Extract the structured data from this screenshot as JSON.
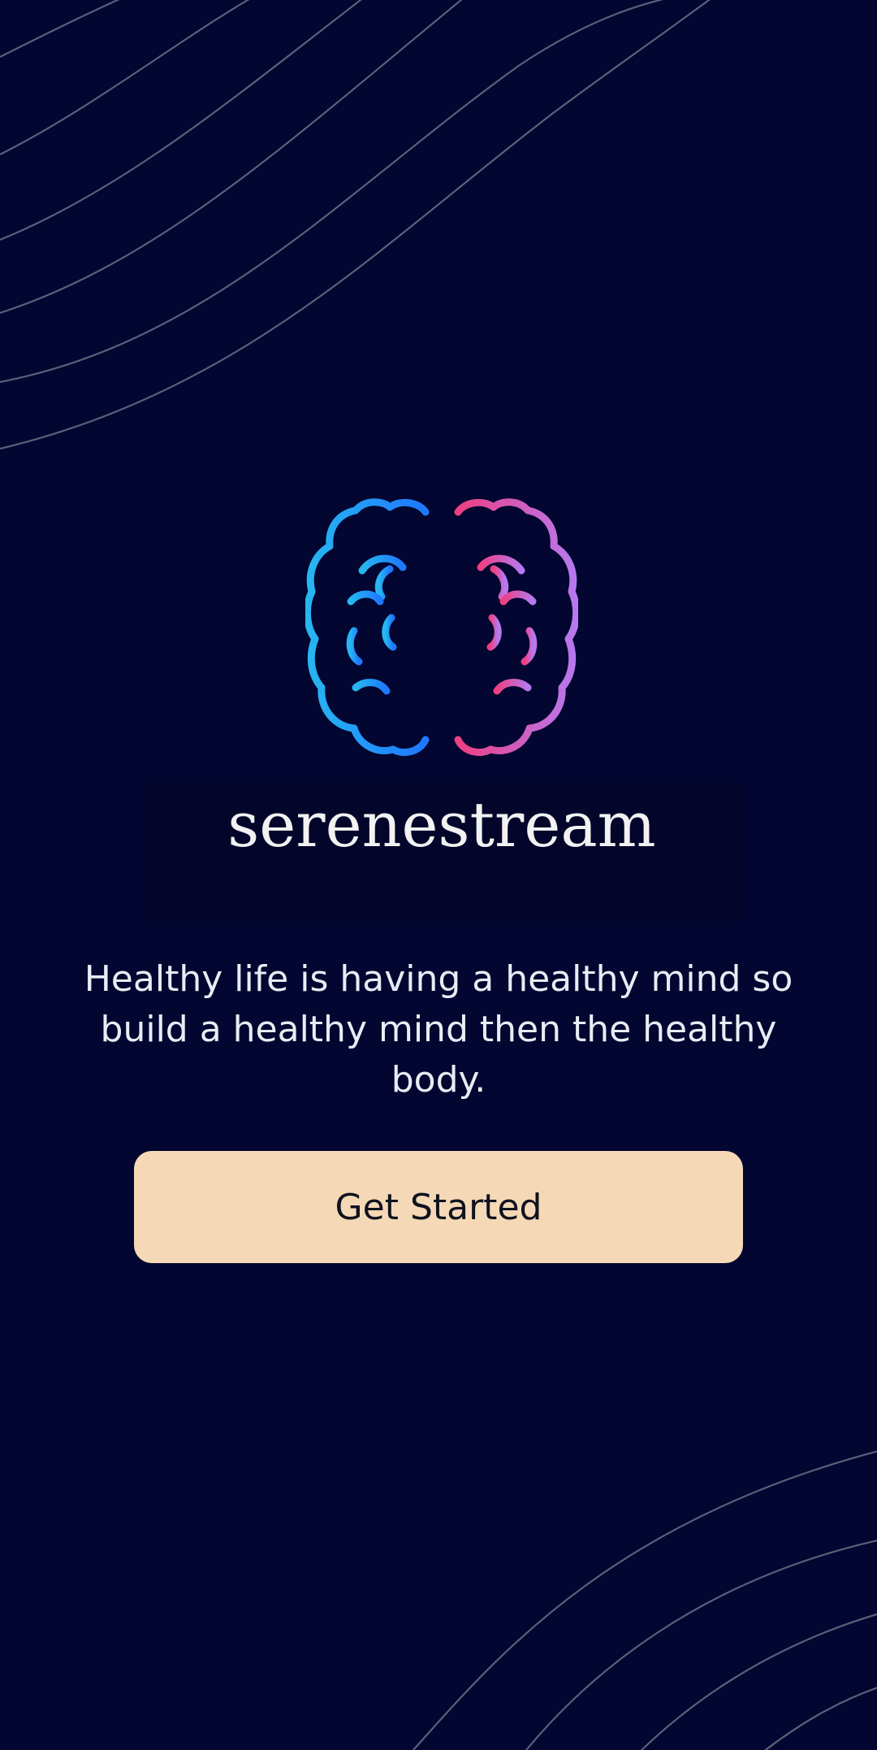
{
  "app": {
    "brand_name": "serenestream",
    "logo_icon": "brain-icon"
  },
  "welcome": {
    "tagline": "Healthy life is having a healthy mind so build a healthy mind then the healthy body.",
    "cta_label": "Get Started"
  },
  "colors": {
    "background": "#020630",
    "button": "#f5d9b6",
    "brain_left": "#1e90ff",
    "brain_right": "#e0529a",
    "wave_lines": "#5b5f78"
  }
}
